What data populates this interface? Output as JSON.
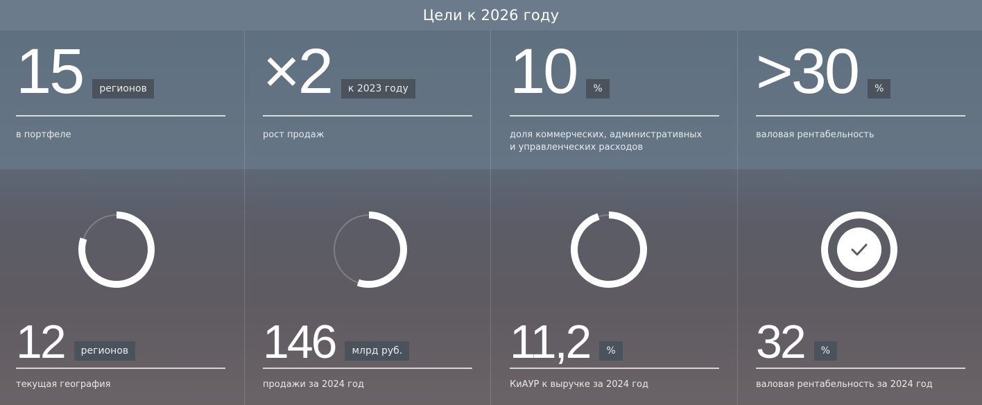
{
  "header": {
    "title": "Цели к 2026 году"
  },
  "targets": [
    {
      "value": "15",
      "unit": "регионов",
      "caption": "в портфеле"
    },
    {
      "value": "×2",
      "unit": "к 2023 году",
      "caption": "рост продаж"
    },
    {
      "value": "10",
      "unit": "%",
      "caption_line1": "доля коммерческих, административных",
      "caption_line2": "и управленческих расходов"
    },
    {
      "value": ">30",
      "unit": "%",
      "caption": "валовая рентабельность"
    }
  ],
  "current": [
    {
      "value": "12",
      "unit": "регионов",
      "caption": "текущая география",
      "progress": 0.8
    },
    {
      "value": "146",
      "unit": "млрд руб.",
      "caption": "продажи за 2024 год",
      "progress": 0.55
    },
    {
      "value": "11,2",
      "unit": "%",
      "caption": "КиАУР к выручке за 2024 год",
      "progress": 0.95
    },
    {
      "value": "32",
      "unit": "%",
      "caption": "валовая рентабельность за 2024 год",
      "progress": 1.0,
      "icon": "checkmark-icon"
    }
  ],
  "colors": {
    "ring": "#ffffff",
    "ring_track": "#7d8088",
    "unit_bg": "#4a525c"
  }
}
